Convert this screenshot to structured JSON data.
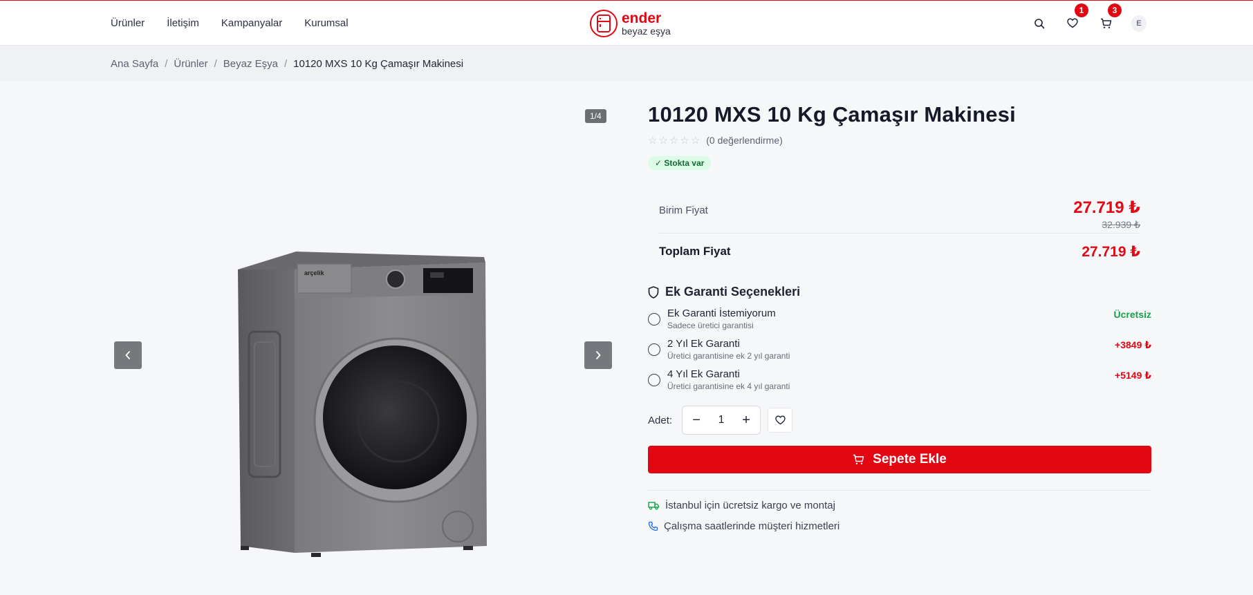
{
  "header": {
    "nav": [
      "Ürünler",
      "İletişim",
      "Kampanyalar",
      "Kurumsal"
    ],
    "brand": {
      "name": "ender",
      "tagline": "beyaz eşya"
    },
    "wishlist_count": "1",
    "cart_count": "3",
    "user_initial": "E"
  },
  "breadcrumb": [
    "Ana Sayfa",
    "Ürünler",
    "Beyaz Eşya",
    "10120 MXS 10 Kg Çamaşır Makinesi"
  ],
  "gallery": {
    "counter": "1/4"
  },
  "product": {
    "title": "10120 MXS 10 Kg Çamaşır Makinesi",
    "rating_count": "(0 değerlendirme)",
    "rating": 0,
    "stock": "✓ Stokta var",
    "unit_label": "Birim Fiyat",
    "unit_price": "27.719 ₺",
    "old_price": "32.939 ₺",
    "total_label": "Toplam Fiyat",
    "total_price": "27.719 ₺"
  },
  "warranty": {
    "title": "Ek Garanti Seçenekleri",
    "options": [
      {
        "name": "Ek Garanti İstemiyorum",
        "desc": "Sadece üretici garantisi",
        "price": "Ücretsiz"
      },
      {
        "name": "2 Yıl Ek Garanti",
        "desc": "Üretici garantisine ek 2 yıl garanti",
        "price": "+3849 ₺"
      },
      {
        "name": "4 Yıl Ek Garanti",
        "desc": "Üretici garantisine ek 4 yıl garanti",
        "price": "+5149 ₺"
      }
    ]
  },
  "quantity": {
    "label": "Adet:",
    "value": "1"
  },
  "cart_button": "Sepete Ekle",
  "features": [
    "İstanbul için ücretsiz kargo ve montaj",
    "Çalışma saatlerinde müşteri hizmetleri"
  ],
  "colors": {
    "accent": "#e30613",
    "success": "#16a34a"
  }
}
